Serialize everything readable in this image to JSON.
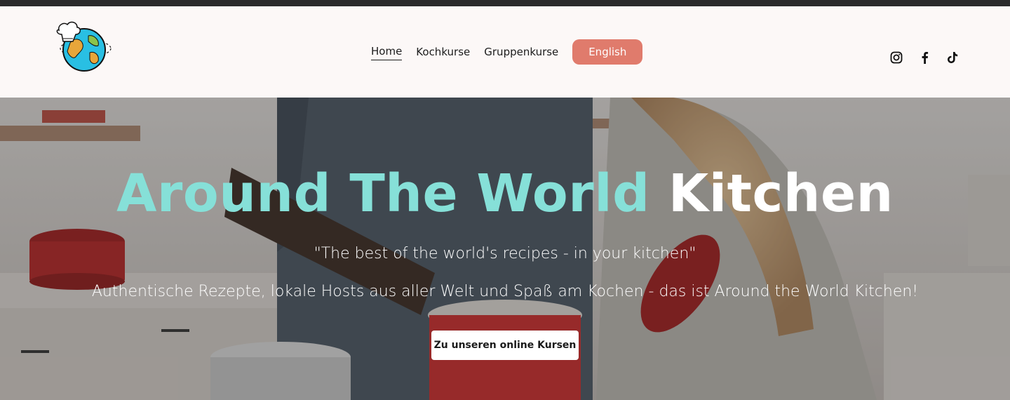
{
  "brand": {
    "logo_icon": "chef-globe-logo"
  },
  "nav": {
    "items": [
      {
        "label": "Home",
        "active": true
      },
      {
        "label": "Kochkurse",
        "active": false
      },
      {
        "label": "Gruppenkurse",
        "active": false
      }
    ],
    "language_button": "English",
    "accent_color": "#e07b6c"
  },
  "social": {
    "icons": [
      "instagram-icon",
      "facebook-icon",
      "tiktok-icon"
    ]
  },
  "hero": {
    "title_part1": "Around The World",
    "title_part2": "Kitchen",
    "title_color_1": "#86e0d8",
    "quote": "\"The best of the world's recipes - in your kitchen\"",
    "text": "Authentische Rezepte, lokale Hosts aus aller Welt und Spaß am Kochen - das ist Around the World Kitchen!",
    "cta_label": "Zu unseren online Kursen"
  }
}
